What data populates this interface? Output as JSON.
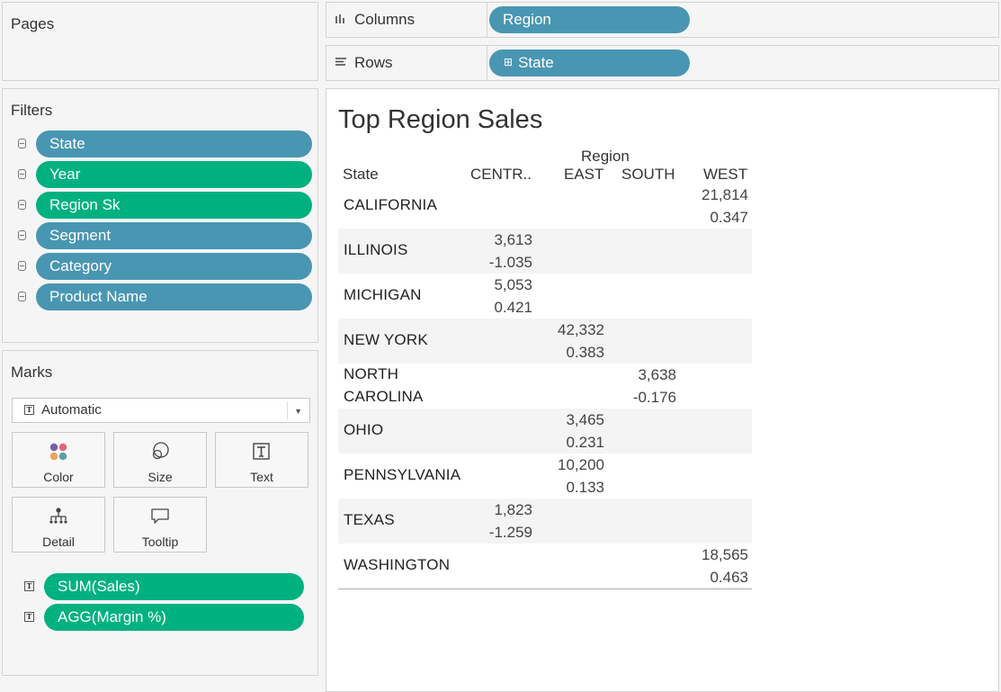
{
  "pages": {
    "title": "Pages"
  },
  "filters": {
    "title": "Filters",
    "items": [
      {
        "label": "State",
        "color": "#4996b2"
      },
      {
        "label": "Year",
        "color": "#00b180"
      },
      {
        "label": "Region Sk",
        "color": "#00b180"
      },
      {
        "label": "Segment",
        "color": "#4996b2"
      },
      {
        "label": "Category",
        "color": "#4996b2"
      },
      {
        "label": "Product Name",
        "color": "#4996b2"
      }
    ]
  },
  "marks": {
    "title": "Marks",
    "mark_type": "Automatic",
    "buttons": {
      "color": "Color",
      "size": "Size",
      "text": "Text",
      "detail": "Detail",
      "tooltip": "Tooltip"
    },
    "fields": [
      {
        "label": "SUM(Sales)",
        "color": "#00b180"
      },
      {
        "label": "AGG(Margin %)",
        "color": "#00b180"
      }
    ]
  },
  "shelves": {
    "columns": {
      "label": "Columns",
      "pill": "Region"
    },
    "rows": {
      "label": "Rows",
      "pill": "State",
      "pill_prefix": "⊞"
    }
  },
  "view": {
    "title": "Top Region Sales",
    "column_header": "Region",
    "row_header": "State",
    "columns": [
      "CENTR..",
      "EAST",
      "SOUTH",
      "WEST"
    ],
    "rows": [
      {
        "state": "CALIFORNIA",
        "column": "WEST",
        "sales": "21,814",
        "margin": "0.347"
      },
      {
        "state": "ILLINOIS",
        "column": "CENTR..",
        "sales": "3,613",
        "margin": "-1.035"
      },
      {
        "state": "MICHIGAN",
        "column": "CENTR..",
        "sales": "5,053",
        "margin": "0.421"
      },
      {
        "state": "NEW YORK",
        "column": "EAST",
        "sales": "42,332",
        "margin": "0.383"
      },
      {
        "state": "NORTH CAROLINA",
        "state_line1": "NORTH",
        "state_line2": "CAROLINA",
        "column": "SOUTH",
        "sales": "3,638",
        "margin": "-0.176"
      },
      {
        "state": "OHIO",
        "column": "EAST",
        "sales": "3,465",
        "margin": "0.231"
      },
      {
        "state": "PENNSYLVANIA",
        "column": "EAST",
        "sales": "10,200",
        "margin": "0.133"
      },
      {
        "state": "TEXAS",
        "column": "CENTR..",
        "sales": "1,823",
        "margin": "-1.259"
      },
      {
        "state": "WASHINGTON",
        "column": "WEST",
        "sales": "18,565",
        "margin": "0.463"
      }
    ]
  },
  "colors": {
    "dimension_pill": "#4996b2",
    "measure_pill": "#00b180"
  }
}
